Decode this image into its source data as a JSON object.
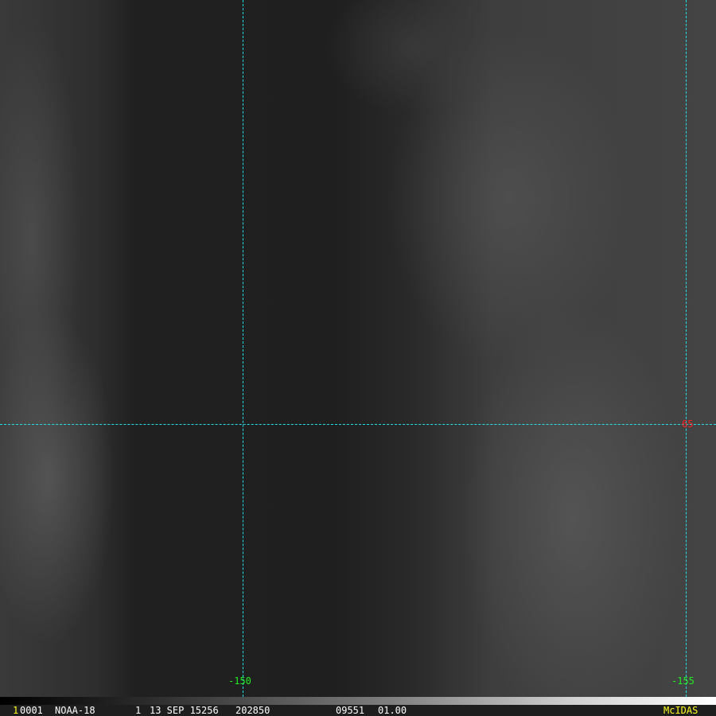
{
  "image": {
    "type": "satellite-visible-imagery",
    "grid_color": "#22e0e8"
  },
  "grid_labels": {
    "lon_left": "-150",
    "lon_right": "-155",
    "lat": "65"
  },
  "status_bar": {
    "frame_number": "1",
    "image_id": "0001",
    "satellite": "NOAA-18",
    "band": "1",
    "date": "13 SEP 15256",
    "time": "202850",
    "res_code": "09551",
    "scale": "01.00",
    "brand": "McIDAS"
  }
}
